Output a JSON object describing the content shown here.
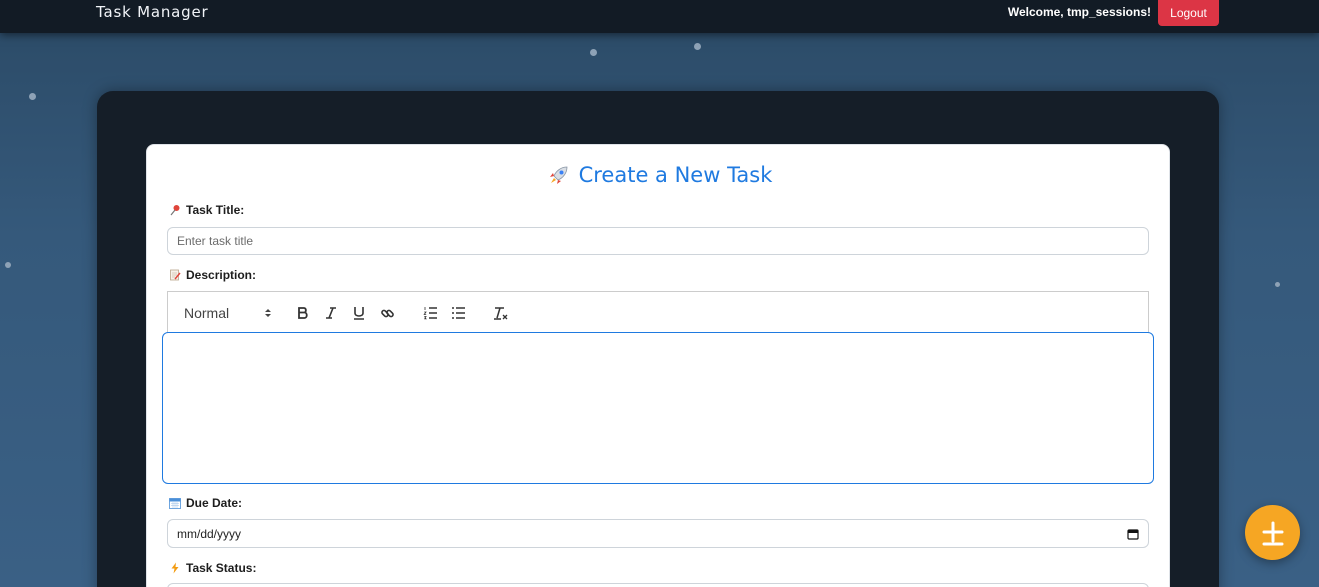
{
  "navbar": {
    "brand": "Task Manager",
    "welcome": "Welcome, tmp_sessions!",
    "logout_label": "Logout"
  },
  "form": {
    "title": "Create a New Task",
    "task_title": {
      "label": "Task Title:",
      "placeholder": "Enter task title",
      "value": ""
    },
    "description": {
      "label": "Description:",
      "format_select": "Normal",
      "content": ""
    },
    "due_date": {
      "label": "Due Date:",
      "value": "mm/dd/yyyy"
    },
    "status": {
      "label": "Task Status:"
    }
  },
  "colors": {
    "accent": "#1f7ae0",
    "logout": "#dc3545",
    "fab": "#f6a623",
    "navbar": "#121b25"
  },
  "icons": {
    "title": "rocket-icon",
    "task_title": "pushpin-icon",
    "description": "memo-icon",
    "due_date": "calendar-icon",
    "status": "lightning-icon",
    "toolbar": [
      "bold-icon",
      "italic-icon",
      "underline-icon",
      "link-icon",
      "ordered-list-icon",
      "bullet-list-icon",
      "clear-format-icon"
    ],
    "fab": "plus-icon"
  }
}
